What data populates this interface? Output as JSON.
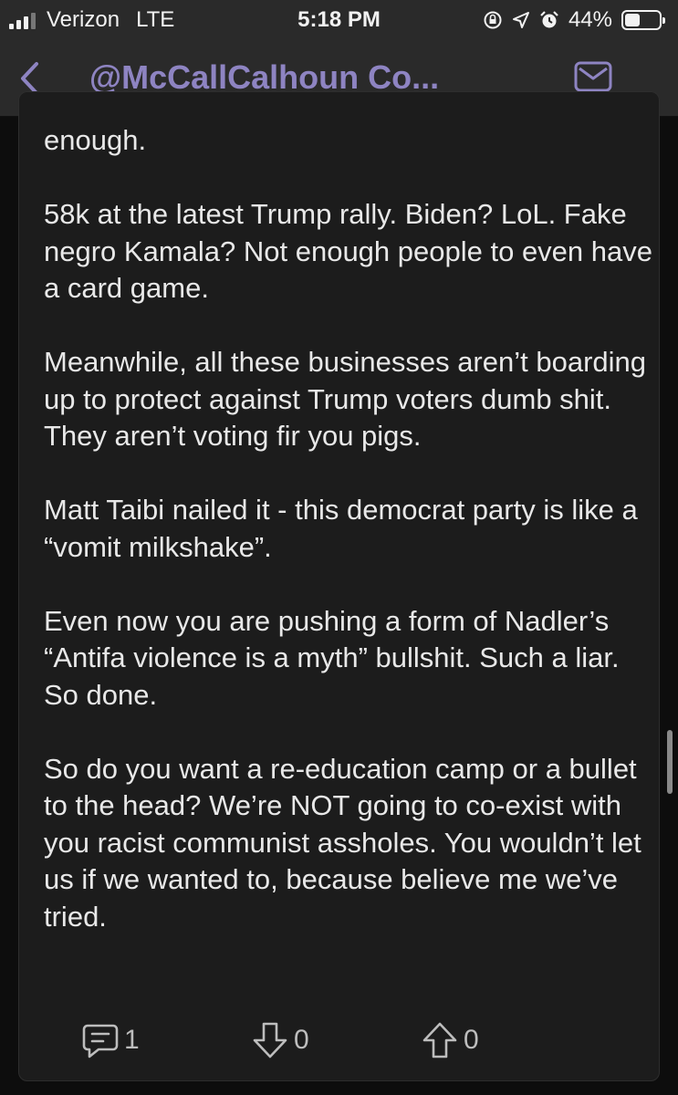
{
  "status_bar": {
    "carrier": "Verizon",
    "network": "LTE",
    "time": "5:18 PM",
    "battery": "44%",
    "battery_level": 0.44
  },
  "nav": {
    "title": "@McCallCalhoun Co..."
  },
  "post": {
    "paragraphs": [
      "enough.",
      "58k at the latest Trump rally. Biden? LoL. Fake negro Kamala? Not enough people to even have a card game.",
      "Meanwhile, all these businesses aren’t boarding up to protect against Trump voters dumb shit. They aren’t voting fir you pigs.",
      "Matt Taibi nailed it - this democrat party is like a “vomit milkshake”.",
      "Even now you are pushing a form of Nadler’s “Antifa violence is a myth” bullshit. Such a liar. So done.",
      "So do you want a re-education camp or a bullet to the head? We’re NOT going to co-exist with you racist communist assholes. You wouldn’t let us if we wanted to, because believe me we’ve tried."
    ]
  },
  "actions": {
    "comments": "1",
    "downvotes": "0",
    "upvotes": "0"
  },
  "colors": {
    "accent": "#8e84c2",
    "background": "#0d0d0d",
    "card": "#1c1c1c",
    "bar": "#2a2a2a"
  }
}
